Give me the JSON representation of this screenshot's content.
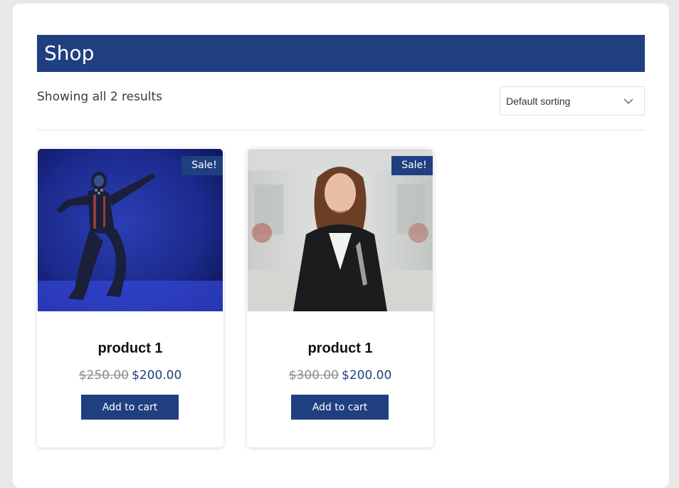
{
  "header": {
    "title": "Shop"
  },
  "results": {
    "text": "Showing all 2 results"
  },
  "sort": {
    "selected": "Default sorting"
  },
  "products": [
    {
      "title": "product 1",
      "badge": "Sale!",
      "price_old": "$250.00",
      "price_new": "$200.00",
      "button_label": "Add to cart"
    },
    {
      "title": "product 1",
      "badge": "Sale!",
      "price_old": "$300.00",
      "price_new": "$200.00",
      "button_label": "Add to cart"
    }
  ],
  "colors": {
    "accent": "#1f3f80",
    "old_price": "#8a8a8a"
  }
}
